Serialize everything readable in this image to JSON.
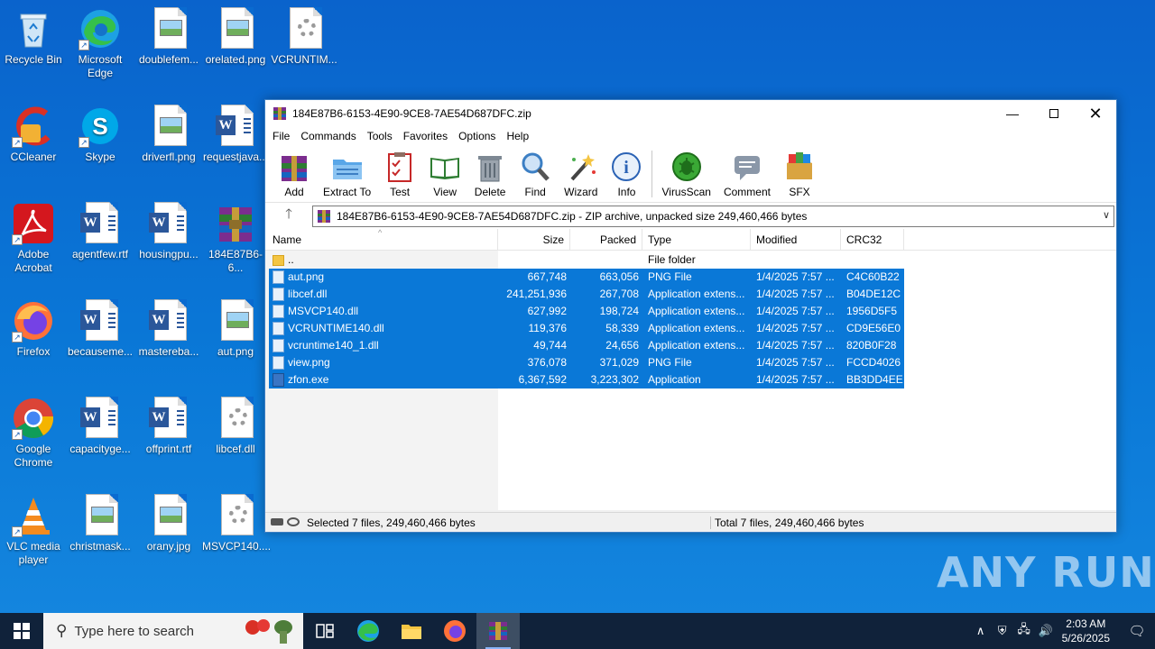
{
  "desktop": {
    "icons": [
      {
        "label": "Recycle Bin"
      },
      {
        "label": "Microsoft Edge"
      },
      {
        "label": "doublefem..."
      },
      {
        "label": "orelated.png"
      },
      {
        "label": "VCRUNTIM..."
      },
      {
        "label": "CCleaner"
      },
      {
        "label": "Skype"
      },
      {
        "label": "driverfl.png"
      },
      {
        "label": "requestjava..."
      },
      {
        "label": "Adobe Acrobat"
      },
      {
        "label": "agentfew.rtf"
      },
      {
        "label": "housingpu..."
      },
      {
        "label": "184E87B6-6..."
      },
      {
        "label": "Firefox"
      },
      {
        "label": "becauseme..."
      },
      {
        "label": "mastereba..."
      },
      {
        "label": "aut.png"
      },
      {
        "label": "Google Chrome"
      },
      {
        "label": "capacityge..."
      },
      {
        "label": "offprint.rtf"
      },
      {
        "label": "libcef.dll"
      },
      {
        "label": "VLC media player"
      },
      {
        "label": "christmask..."
      },
      {
        "label": "orany.jpg"
      },
      {
        "label": "MSVCP140...."
      }
    ]
  },
  "window": {
    "title": "184E87B6-6153-4E90-9CE8-7AE54D687DFC.zip",
    "menu": [
      "File",
      "Commands",
      "Tools",
      "Favorites",
      "Options",
      "Help"
    ],
    "toolbar": [
      "Add",
      "Extract To",
      "Test",
      "View",
      "Delete",
      "Find",
      "Wizard",
      "Info",
      "VirusScan",
      "Comment",
      "SFX"
    ],
    "address": "184E87B6-6153-4E90-9CE8-7AE54D687DFC.zip - ZIP archive, unpacked size 249,460,466 bytes",
    "columns": [
      "Name",
      "Size",
      "Packed",
      "Type",
      "Modified",
      "CRC32"
    ],
    "parent_row": {
      "name": "..",
      "type": "File folder"
    },
    "files": [
      {
        "name": "aut.png",
        "size": "667,748",
        "packed": "663,056",
        "type": "PNG File",
        "modified": "1/4/2025 7:57 ...",
        "crc": "C4C60B22"
      },
      {
        "name": "libcef.dll",
        "size": "241,251,936",
        "packed": "267,708",
        "type": "Application extens...",
        "modified": "1/4/2025 7:57 ...",
        "crc": "B04DE12C"
      },
      {
        "name": "MSVCP140.dll",
        "size": "627,992",
        "packed": "198,724",
        "type": "Application extens...",
        "modified": "1/4/2025 7:57 ...",
        "crc": "1956D5F5"
      },
      {
        "name": "VCRUNTIME140.dll",
        "size": "119,376",
        "packed": "58,339",
        "type": "Application extens...",
        "modified": "1/4/2025 7:57 ...",
        "crc": "CD9E56E0"
      },
      {
        "name": "vcruntime140_1.dll",
        "size": "49,744",
        "packed": "24,656",
        "type": "Application extens...",
        "modified": "1/4/2025 7:57 ...",
        "crc": "820B0F28"
      },
      {
        "name": "view.png",
        "size": "376,078",
        "packed": "371,029",
        "type": "PNG File",
        "modified": "1/4/2025 7:57 ...",
        "crc": "FCCD4026"
      },
      {
        "name": "zfon.exe",
        "size": "6,367,592",
        "packed": "3,223,302",
        "type": "Application",
        "modified": "1/4/2025 7:57 ...",
        "crc": "BB3DD4EE"
      }
    ],
    "status_left": "Selected 7 files, 249,460,466 bytes",
    "status_right": "Total 7 files, 249,460,466 bytes"
  },
  "watermark": "ANY RUN",
  "taskbar": {
    "search_placeholder": "Type here to search",
    "time": "2:03 AM",
    "date": "5/26/2025"
  },
  "colors": {
    "selection": "#0a78d7",
    "taskbar": "#10223a",
    "desktop": "#0a78d7"
  }
}
